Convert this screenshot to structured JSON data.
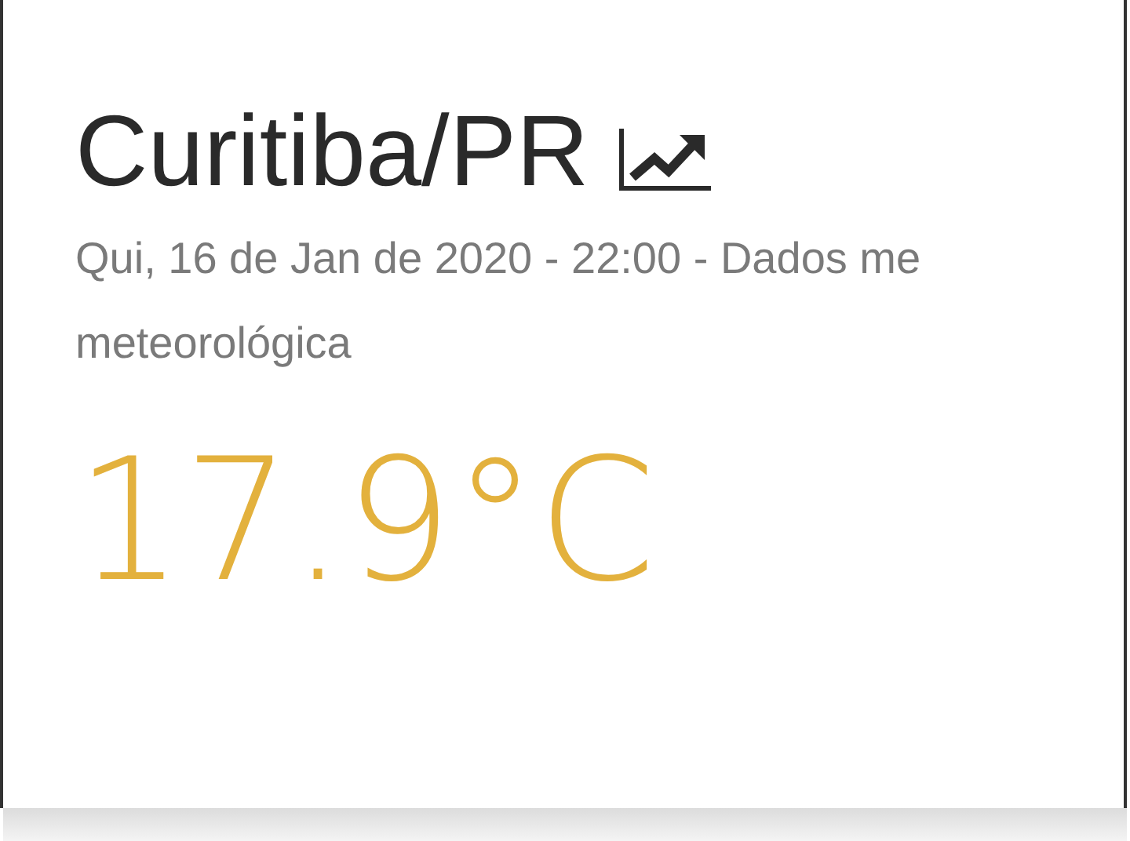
{
  "city": {
    "title": "Curitiba/PR"
  },
  "subtitle_lines": [
    "Qui, 16 de Jan de 2020 - 22:00 - Dados me",
    "meteorológica"
  ],
  "temperature": "17.9°C"
}
